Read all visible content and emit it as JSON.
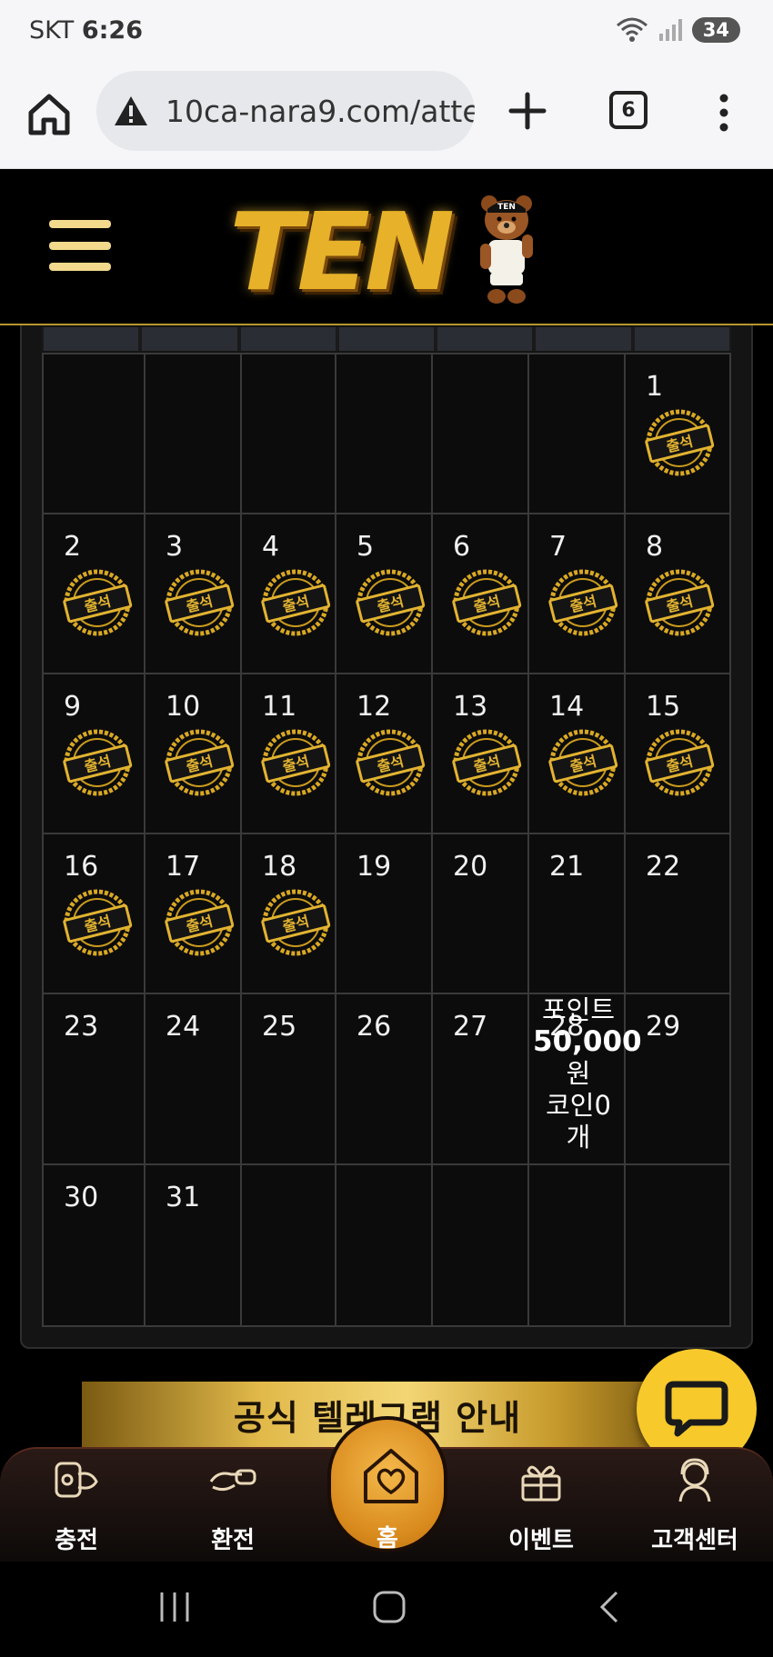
{
  "status_bar": {
    "carrier": "SKT",
    "time": "6:26",
    "battery": "34"
  },
  "browser": {
    "url": "10ca-nara9.com/atte",
    "tab_count": "6"
  },
  "site": {
    "logo_text": "TEN",
    "bear_cap_text": "TEN"
  },
  "calendar": {
    "stamp_label": "출석",
    "rows": [
      [
        null,
        null,
        null,
        null,
        null,
        null,
        {
          "day": "1",
          "stamp": true
        }
      ],
      [
        {
          "day": "2",
          "stamp": true
        },
        {
          "day": "3",
          "stamp": true
        },
        {
          "day": "4",
          "stamp": true
        },
        {
          "day": "5",
          "stamp": true
        },
        {
          "day": "6",
          "stamp": true
        },
        {
          "day": "7",
          "stamp": true
        },
        {
          "day": "8",
          "stamp": true
        }
      ],
      [
        {
          "day": "9",
          "stamp": true
        },
        {
          "day": "10",
          "stamp": true
        },
        {
          "day": "11",
          "stamp": true
        },
        {
          "day": "12",
          "stamp": true
        },
        {
          "day": "13",
          "stamp": true
        },
        {
          "day": "14",
          "stamp": true
        },
        {
          "day": "15",
          "stamp": true
        }
      ],
      [
        {
          "day": "16",
          "stamp": true
        },
        {
          "day": "17",
          "stamp": true
        },
        {
          "day": "18",
          "stamp": true
        },
        {
          "day": "19",
          "stamp": false
        },
        {
          "day": "20",
          "stamp": false
        },
        {
          "day": "21",
          "stamp": false
        },
        {
          "day": "22",
          "stamp": false
        }
      ],
      [
        {
          "day": "23",
          "stamp": false
        },
        {
          "day": "24",
          "stamp": false
        },
        {
          "day": "25",
          "stamp": false
        },
        {
          "day": "26",
          "stamp": false
        },
        {
          "day": "27",
          "stamp": false
        },
        {
          "day": "28",
          "stamp": false
        },
        {
          "day": "29",
          "stamp": false
        }
      ],
      [
        {
          "day": "30",
          "stamp": false
        },
        {
          "day": "31",
          "stamp": false
        },
        null,
        null,
        null,
        null,
        null
      ]
    ],
    "reward": {
      "line1": "포인트",
      "line2": "50,000",
      "line3": "원",
      "line4": "코인0",
      "line5": "개"
    }
  },
  "banner": {
    "text": "공식 텔레그램 안내"
  },
  "bottom_nav": {
    "charge": "충전",
    "exchange": "환전",
    "home": "홈",
    "event": "이벤트",
    "support": "고객센터"
  },
  "colors": {
    "gold": "#e7b22a",
    "chat_yellow": "#f7c92b",
    "panel_bg": "#0c0c0c"
  }
}
